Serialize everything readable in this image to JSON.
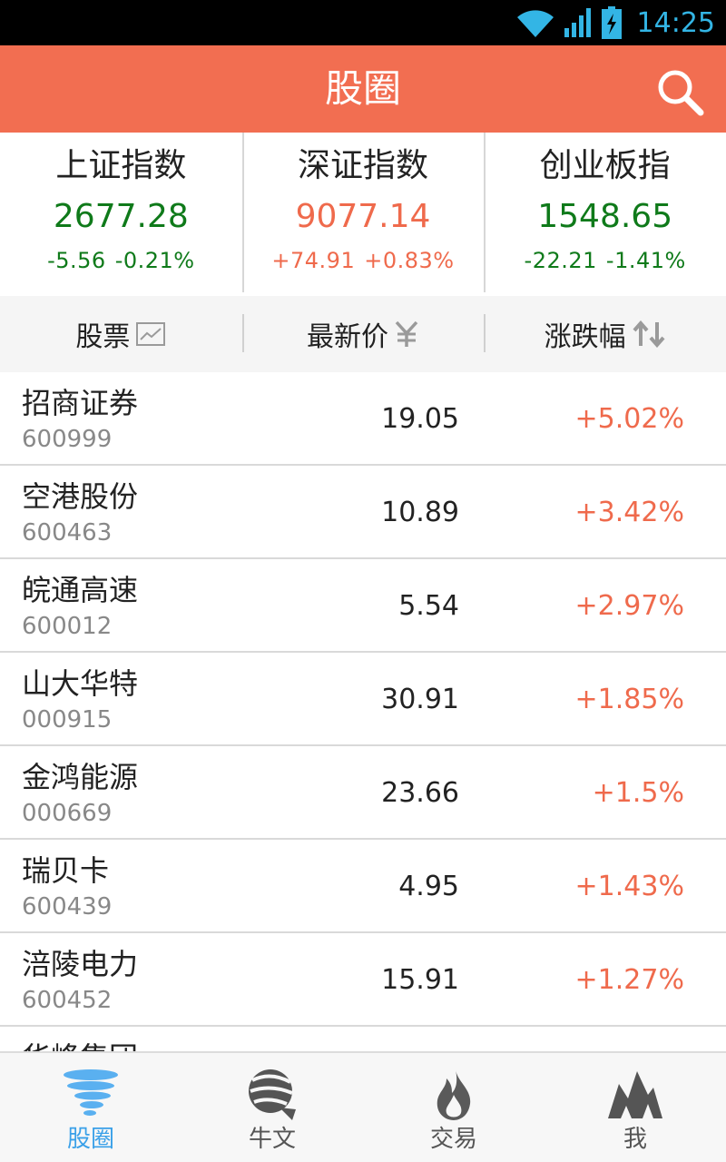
{
  "status_bar": {
    "time": "14:25",
    "icons": [
      "wifi-icon",
      "cell-signal-icon",
      "battery-charging-icon"
    ]
  },
  "header": {
    "title": "股圈",
    "search_icon": "search-icon"
  },
  "indices": [
    {
      "name": "上证指数",
      "value": "2677.28",
      "change": "-5.56",
      "percent": "-0.21%",
      "trend": "down"
    },
    {
      "name": "深证指数",
      "value": "9077.14",
      "change": "+74.91",
      "percent": "+0.83%",
      "trend": "up"
    },
    {
      "name": "创业板指",
      "value": "1548.65",
      "change": "-22.21",
      "percent": "-1.41%",
      "trend": "down"
    }
  ],
  "columns": {
    "stock": "股票",
    "stock_icon": "chart-icon",
    "price": "最新价",
    "price_icon": "yuan-icon",
    "change": "涨跌幅",
    "change_icon": "sort-icon"
  },
  "stocks": [
    {
      "name": "招商证券",
      "code": "600999",
      "price": "19.05",
      "change": "+5.02%"
    },
    {
      "name": "空港股份",
      "code": "600463",
      "price": "10.89",
      "change": "+3.42%"
    },
    {
      "name": "皖通高速",
      "code": "600012",
      "price": "5.54",
      "change": "+2.97%"
    },
    {
      "name": "山大华特",
      "code": "000915",
      "price": "30.91",
      "change": "+1.85%"
    },
    {
      "name": "金鸿能源",
      "code": "000669",
      "price": "23.66",
      "change": "+1.5%"
    },
    {
      "name": "瑞贝卡",
      "code": "600439",
      "price": "4.95",
      "change": "+1.43%"
    },
    {
      "name": "涪陵电力",
      "code": "600452",
      "price": "15.91",
      "change": "+1.27%"
    },
    {
      "name": "华峰集团",
      "code": "",
      "price": "",
      "change": ""
    }
  ],
  "nav": [
    {
      "label": "股圈",
      "icon": "tornado-icon",
      "active": true
    },
    {
      "label": "牛文",
      "icon": "bull-icon",
      "active": false
    },
    {
      "label": "交易",
      "icon": "flame-icon",
      "active": false
    },
    {
      "label": "我",
      "icon": "mountain-icon",
      "active": false
    }
  ],
  "colors": {
    "accent": "#f26e51",
    "up": "#ef6a4c",
    "down": "#0f7a1a",
    "nav_active": "#3aa0e8",
    "status_time": "#33b5e5"
  }
}
